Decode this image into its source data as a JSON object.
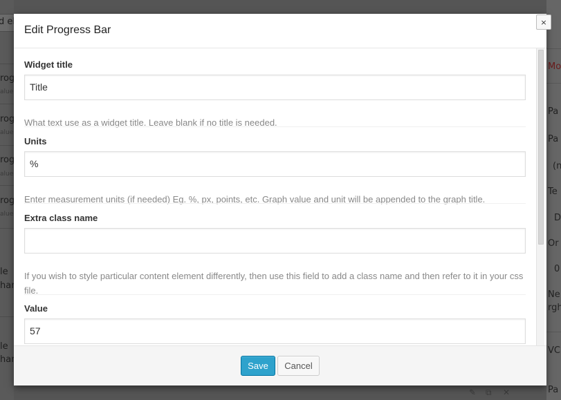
{
  "modal": {
    "title": "Edit Progress Bar",
    "close_label": "×"
  },
  "fields": [
    {
      "label": "Widget title",
      "value": "Title",
      "help": "What text use as a widget title. Leave blank if no title is needed."
    },
    {
      "label": "Units",
      "value": "%",
      "help": "Enter measurement units (if needed) Eg. %, px, points, etc. Graph value and unit will be appended to the graph title."
    },
    {
      "label": "Extra class name",
      "value": "",
      "help": "If you wish to style particular content element differently, then use this field to add a class name and then refer to it in your css file."
    },
    {
      "label": "Value",
      "value": "57"
    }
  ],
  "footer": {
    "save_label": "Save",
    "cancel_label": "Cancel"
  },
  "background": {
    "left_fragments": [
      "d el",
      "rog",
      "alue",
      "rog",
      "alue",
      "rog",
      "alue",
      "rog",
      "alue",
      "le",
      "har",
      "le",
      "har"
    ],
    "right_fragments": [
      "Mo",
      "Pa",
      "Pa",
      "(n",
      "Te",
      "D",
      "Or",
      "0",
      "Ne",
      "rgh",
      "VC",
      "Pa"
    ]
  },
  "colors": {
    "primary_button": "#2ea2cc",
    "overlay": "#555555"
  }
}
